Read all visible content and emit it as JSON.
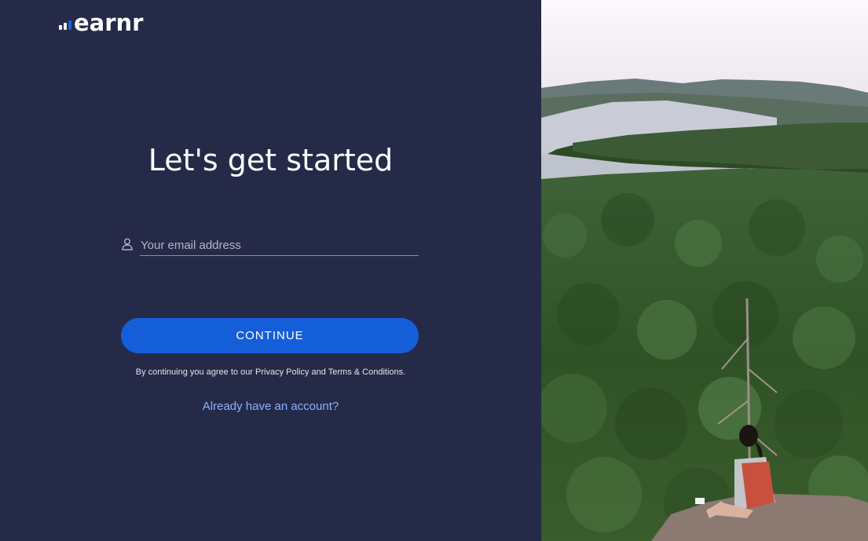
{
  "brand": {
    "name": "earnr",
    "bar_colors": [
      "#ffffff",
      "#ffffff",
      "#1a5fe0"
    ]
  },
  "heading": "Let's get started",
  "email": {
    "icon": "user-icon",
    "placeholder": "Your email address",
    "value": ""
  },
  "continue_label": "CONTINUE",
  "terms": {
    "prefix": "By continuing you agree to our ",
    "privacy": "Privacy Policy",
    "and": " and ",
    "conditions": "Terms & Conditions",
    "suffix": "."
  },
  "signin_link": "Already have an account?",
  "colors": {
    "panel_bg": "#242a47",
    "accent": "#155ed9",
    "link": "#8ab4ff"
  },
  "hero_image": {
    "subject": "hiker-overlooking-lake-forest"
  }
}
